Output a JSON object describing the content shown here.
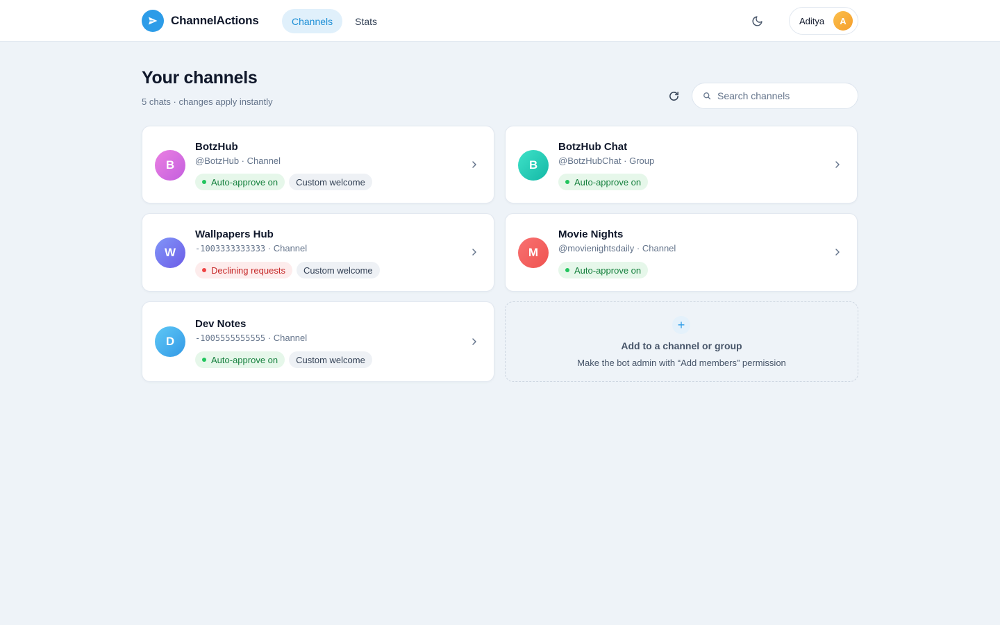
{
  "app": {
    "name": "ChannelActions",
    "accent": "#2d9ce8"
  },
  "nav": {
    "tabs": [
      {
        "label": "Channels",
        "active": true
      },
      {
        "label": "Stats",
        "active": false
      }
    ]
  },
  "user": {
    "name": "Aditya",
    "initial": "A"
  },
  "header": {
    "title": "Your channels",
    "subtitle": "5 chats · changes apply instantly"
  },
  "search": {
    "placeholder": "Search channels",
    "value": ""
  },
  "channels": [
    {
      "initial": "B",
      "name": "BotzHub",
      "handle": "@BotzHub",
      "handle_mono": false,
      "type": "Channel",
      "status": {
        "label": "Auto-approve on",
        "kind": "approve"
      },
      "custom_welcome": "Custom welcome"
    },
    {
      "initial": "B",
      "name": "BotzHub Chat",
      "handle": "@BotzHubChat",
      "handle_mono": false,
      "type": "Group",
      "status": {
        "label": "Auto-approve on",
        "kind": "approve"
      },
      "custom_welcome": null
    },
    {
      "initial": "W",
      "name": "Wallpapers Hub",
      "handle": "-1003333333333",
      "handle_mono": true,
      "type": "Channel",
      "status": {
        "label": "Declining requests",
        "kind": "decline"
      },
      "custom_welcome": "Custom welcome"
    },
    {
      "initial": "M",
      "name": "Movie Nights",
      "handle": "@movienightsdaily",
      "handle_mono": false,
      "type": "Channel",
      "status": {
        "label": "Auto-approve on",
        "kind": "approve"
      },
      "custom_welcome": null
    },
    {
      "initial": "D",
      "name": "Dev Notes",
      "handle": "-1005555555555",
      "handle_mono": true,
      "type": "Channel",
      "status": {
        "label": "Auto-approve on",
        "kind": "approve"
      },
      "custom_welcome": "Custom welcome"
    }
  ],
  "add_card": {
    "title": "Add to a channel or group",
    "subtitle": "Make the bot admin with “Add members” permission"
  }
}
